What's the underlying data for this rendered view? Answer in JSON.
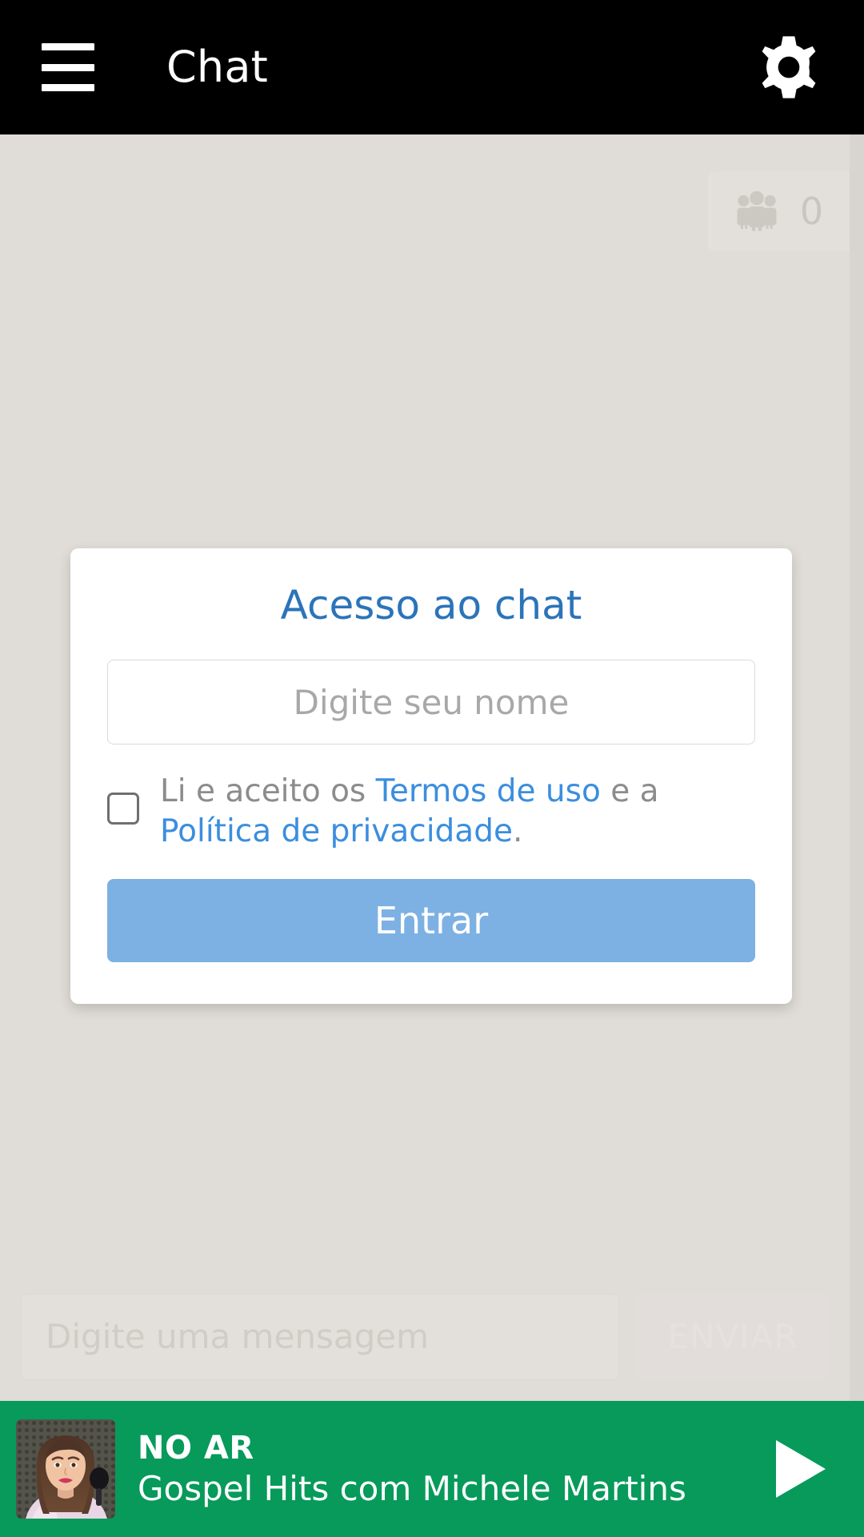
{
  "header": {
    "title": "Chat",
    "menu_icon": "hamburger-menu-icon",
    "settings_icon": "gear-icon"
  },
  "chat": {
    "users_badge": {
      "icon": "people-group-icon",
      "count": "0"
    },
    "composer": {
      "placeholder": "Digite uma mensagem",
      "send_label": "ENVIAR"
    }
  },
  "modal": {
    "title": "Acesso ao chat",
    "name_input": {
      "placeholder": "Digite seu nome",
      "value": ""
    },
    "terms": {
      "prefix": "Li e aceito os ",
      "terms_link": "Termos de uso",
      "middle": " e a ",
      "privacy_link": "Política de privacidade",
      "suffix": "."
    },
    "submit_label": "Entrar",
    "checkbox_checked": false
  },
  "player": {
    "status": "NO AR",
    "program": "Gospel Hits com Michele Martins",
    "play_icon": "play-triangle-icon",
    "thumbnail_alt": "michele-martins-photo"
  },
  "colors": {
    "header_bg": "#000000",
    "page_bg": "#ddd9d4",
    "modal_title": "#2b74b9",
    "link": "#3b8ede",
    "primary_button": "#7db1e3",
    "player_bg": "#079a5b",
    "text_muted": "#8c8c8c"
  }
}
